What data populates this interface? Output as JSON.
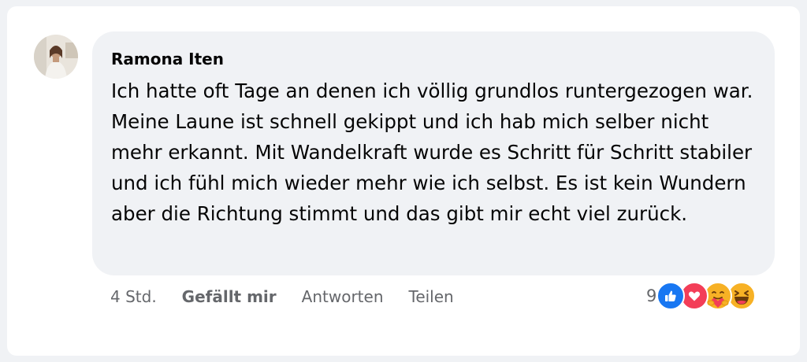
{
  "comment": {
    "author": "Ramona Iten",
    "text": "Ich hatte oft Tage an denen ich völlig grundlos runtergezogen war. Meine Laune ist schnell gekippt und ich hab mich selber nicht mehr erkannt. Mit Wandelkraft wurde es Schritt für Schritt stabiler und ich fühl mich wieder mehr wie ich selbst. Es ist kein Wundern aber die Richtung stimmt und das gibt mir echt viel zurück."
  },
  "actions": {
    "time": "4 Std.",
    "like_label": "Gefällt mir",
    "reply_label": "Antworten",
    "share_label": "Teilen"
  },
  "reactions": {
    "count": "9",
    "icons": [
      "like-icon",
      "love-icon",
      "care-icon",
      "haha-icon"
    ],
    "colors": {
      "like": "#1877f2",
      "love": "#f33e58",
      "care": "#f7b125",
      "haha": "#f7b125"
    }
  }
}
